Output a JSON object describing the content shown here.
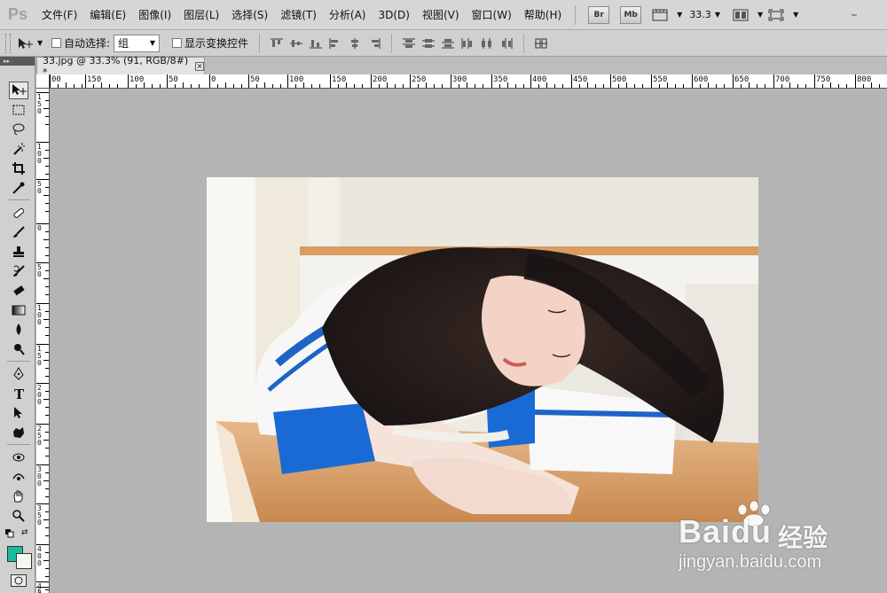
{
  "app": {
    "logo": "Ps"
  },
  "menu": [
    "文件(F)",
    "编辑(E)",
    "图像(I)",
    "图层(L)",
    "选择(S)",
    "滤镜(T)",
    "分析(A)",
    "3D(D)",
    "视图(V)",
    "窗口(W)",
    "帮助(H)"
  ],
  "toolbar_right": {
    "bridge": "Br",
    "mini_bridge": "Mb",
    "zoom": "33.3"
  },
  "options": {
    "auto_select_label": "自动选择:",
    "auto_select_value": "组",
    "show_transform_label": "显示变换控件"
  },
  "document": {
    "tab_title": "33.jpg @ 33.3% (91, RGB/8#) *",
    "close": "×"
  },
  "ruler_h": [
    "00",
    "150",
    "100",
    "50",
    "0",
    "50",
    "100",
    "150",
    "200",
    "250",
    "300",
    "350",
    "400",
    "450",
    "500",
    "550",
    "600",
    "650",
    "700",
    "750",
    "800"
  ],
  "ruler_v": [
    "150",
    "100",
    "50",
    "0",
    "50",
    "100",
    "150",
    "200",
    "250",
    "300",
    "350",
    "400",
    "450",
    "5"
  ],
  "colors": {
    "foreground": "#1abc9c",
    "background": "#f3f9f0"
  },
  "watermark": {
    "brand": "Bai",
    "brand2": "du",
    "cn": "经验",
    "url": "jingyan.baidu.com"
  }
}
